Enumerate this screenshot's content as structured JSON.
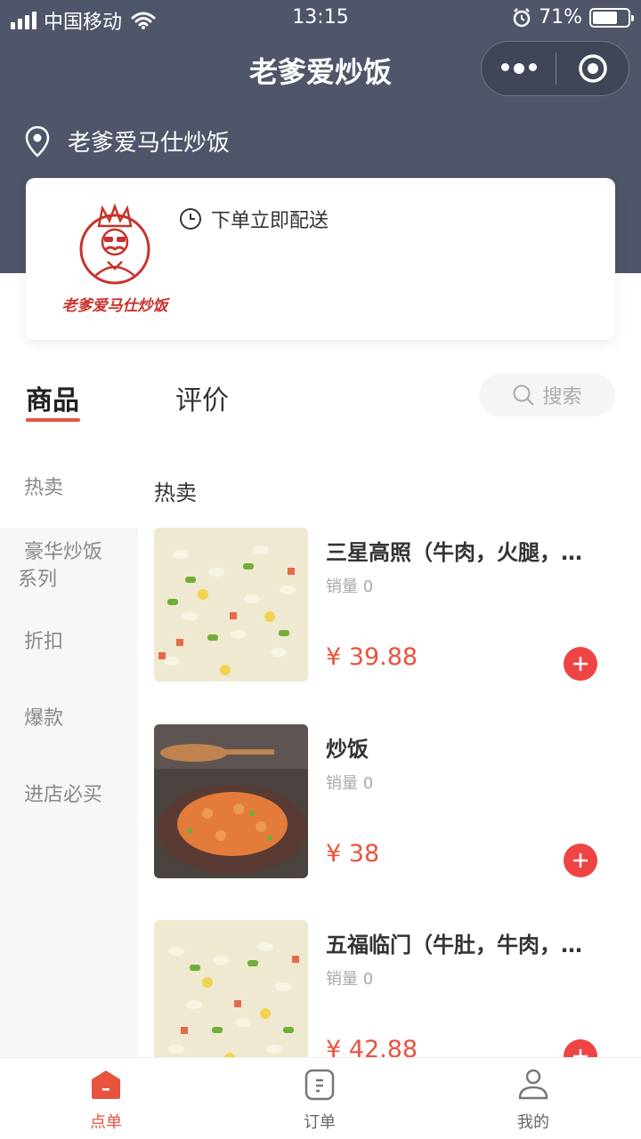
{
  "status_bar": {
    "carrier": "中国移动",
    "time": "13:15",
    "battery": "71%"
  },
  "nav": {
    "title": "老爹爱炒饭"
  },
  "store": {
    "name": "老爹爱马仕炒饭",
    "logo_text": "老爹爱马仕炒饭",
    "delivery_text": "下单立即配送"
  },
  "tabs": {
    "goods": "商品",
    "reviews": "评价",
    "search_placeholder": "搜索"
  },
  "categories": [
    "热卖",
    "豪华炒饭系列",
    "折扣",
    "爆款",
    "进店必买"
  ],
  "list": {
    "section_title": "热卖",
    "products": [
      {
        "name": "三星高照（牛肉，火腿，…",
        "sales": "销量 0",
        "price": "¥ 39.88"
      },
      {
        "name": "炒饭",
        "sales": "销量 0",
        "price": "¥ 38"
      },
      {
        "name": "五福临门（牛肚，牛肉，…",
        "sales": "销量 0",
        "price": "¥ 42.88"
      }
    ]
  },
  "tabbar": {
    "order": "点单",
    "orders": "订单",
    "mine": "我的"
  },
  "colors": {
    "header_bg": "#505669",
    "accent": "#e8533e",
    "add_button": "#ef4444"
  }
}
